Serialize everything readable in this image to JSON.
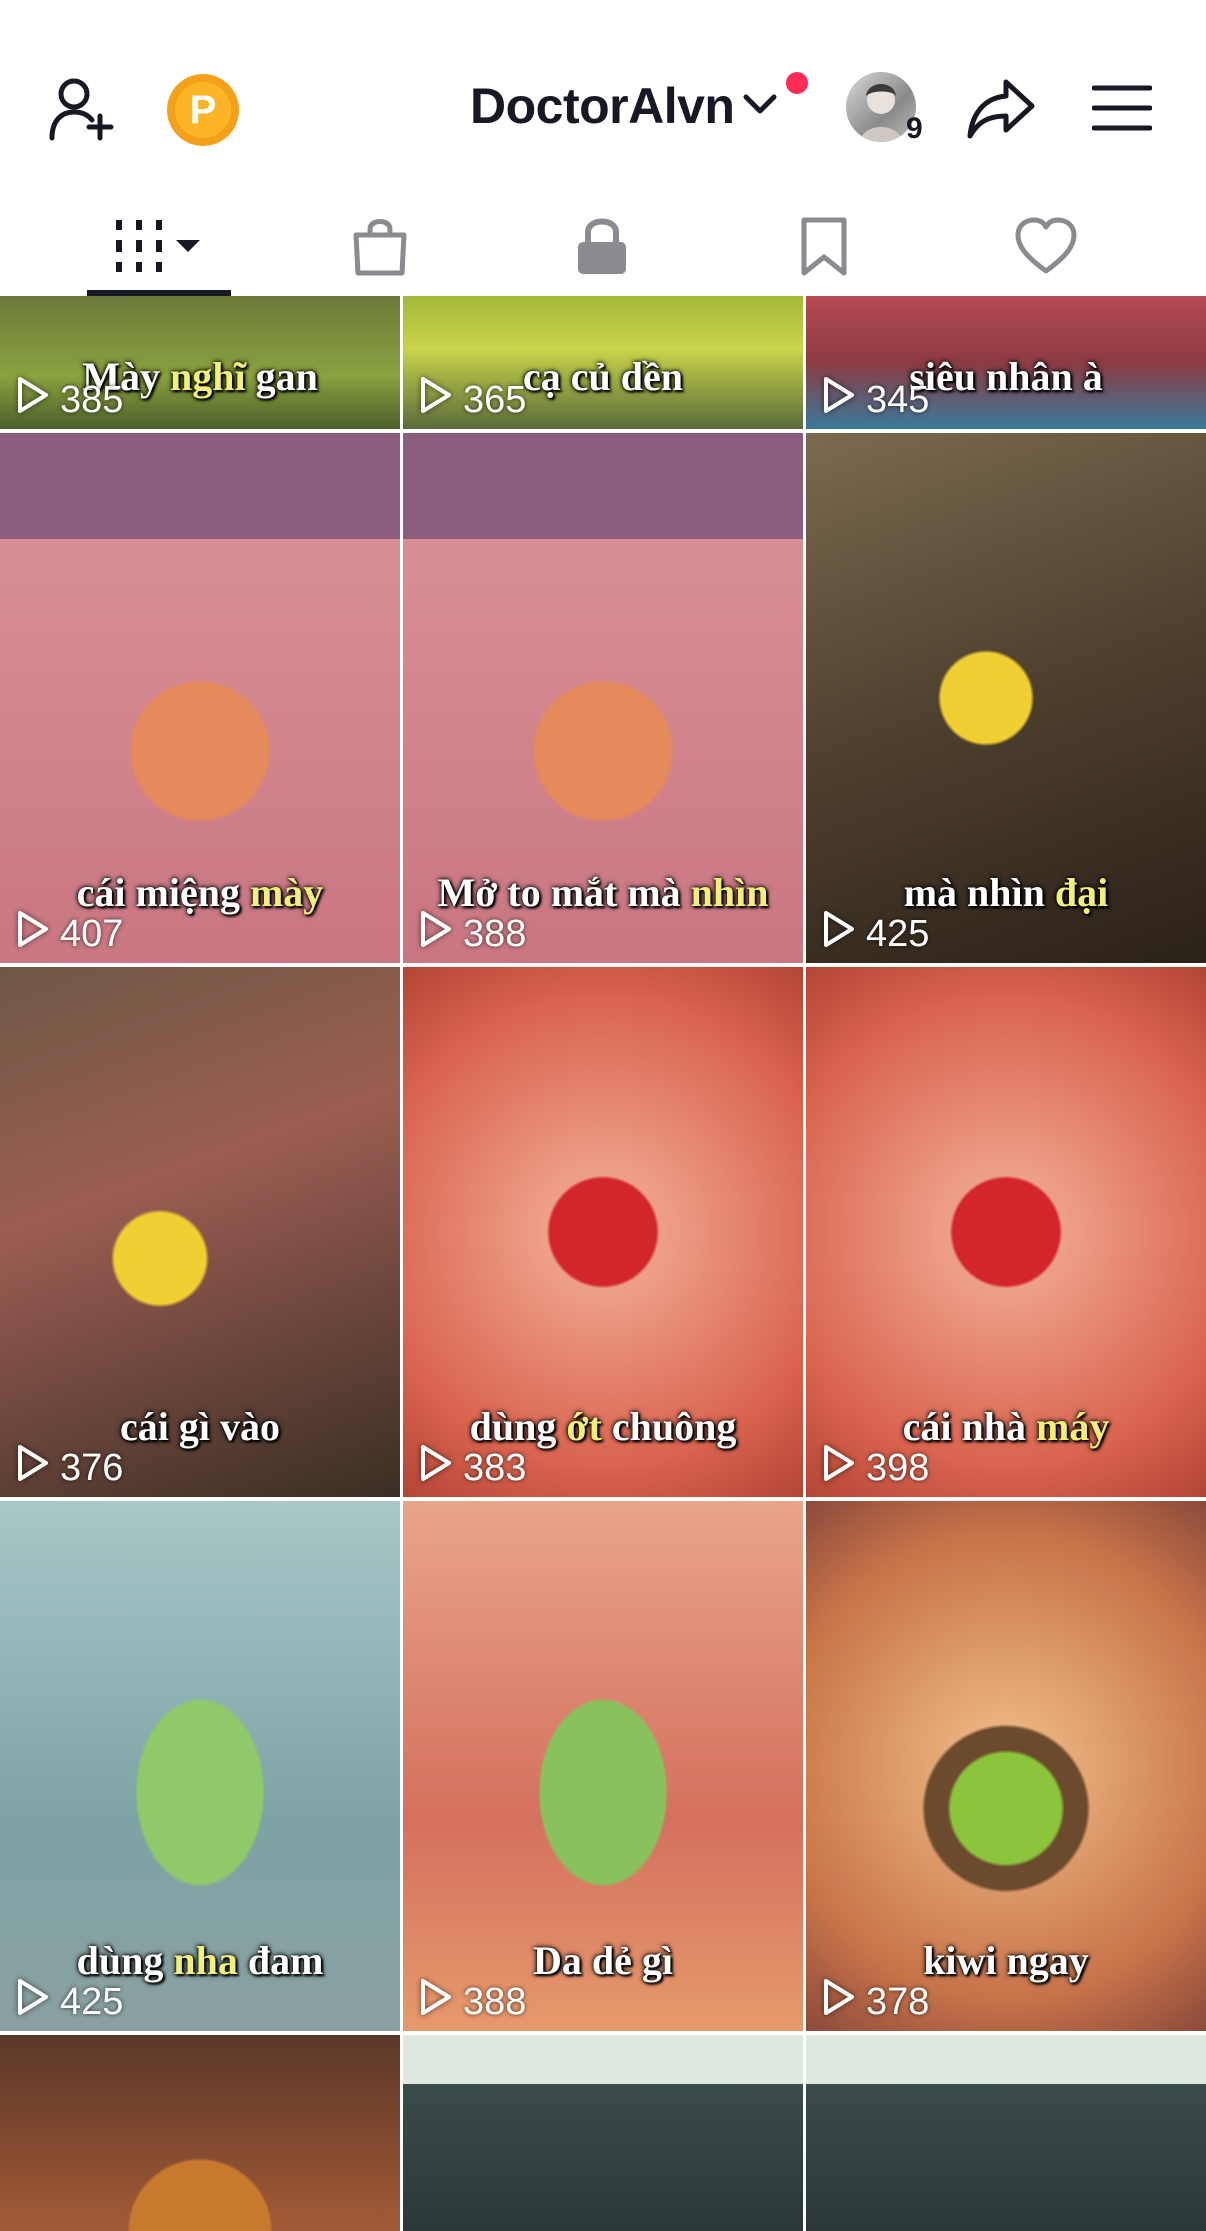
{
  "header": {
    "username": "DoctorAlvn",
    "premium_badge": "P",
    "following_count": "9",
    "icons": [
      "add-friend-icon",
      "premium-badge-icon",
      "chevron-down-icon",
      "share-icon",
      "menu-icon"
    ]
  },
  "tabs": [
    {
      "name": "videos",
      "icon": "grid-icon",
      "active": true
    },
    {
      "name": "shop",
      "icon": "bag-icon",
      "active": false
    },
    {
      "name": "private",
      "icon": "lock-icon",
      "active": false
    },
    {
      "name": "saved",
      "icon": "bookmark-icon",
      "active": false
    },
    {
      "name": "liked",
      "icon": "heart-icon",
      "active": false
    }
  ],
  "colors": {
    "accent_red": "#fe2c55",
    "text": "#161823",
    "badge_orange": "#f5a01a",
    "caption_highlight": "#f3f07a"
  },
  "videos": [
    {
      "views": "385",
      "caption_a": "Mày ",
      "caption_hl": "nghĩ",
      "caption_b": " gan"
    },
    {
      "views": "365",
      "caption_a": "cạ củ dền",
      "caption_hl": "",
      "caption_b": ""
    },
    {
      "views": "345",
      "caption_a": "siêu nhân à",
      "caption_hl": "",
      "caption_b": ""
    },
    {
      "views": "407",
      "caption_a": "cái miệng ",
      "caption_hl": "mày",
      "caption_b": ""
    },
    {
      "views": "388",
      "caption_a": "Mở to mắt mà ",
      "caption_hl": "nhìn",
      "caption_b": ""
    },
    {
      "views": "425",
      "caption_a": "mà nhìn ",
      "caption_hl": "đại",
      "caption_b": ""
    },
    {
      "views": "376",
      "caption_a": "cái gì vào",
      "caption_hl": "",
      "caption_b": ""
    },
    {
      "views": "383",
      "caption_a": "dùng ",
      "caption_hl": "ớt",
      "caption_b": " chuông"
    },
    {
      "views": "398",
      "caption_a": "cái nhà ",
      "caption_hl": "máy",
      "caption_b": ""
    },
    {
      "views": "425",
      "caption_a": "dùng ",
      "caption_hl": "nha",
      "caption_b": " đam"
    },
    {
      "views": "388",
      "caption_a": "Da dẻ gì",
      "caption_hl": "",
      "caption_b": ""
    },
    {
      "views": "378",
      "caption_a": "kiwi ngay",
      "caption_hl": "",
      "caption_b": ""
    },
    {
      "views": "",
      "caption_a": "",
      "caption_hl": "",
      "caption_b": ""
    },
    {
      "views": "",
      "caption_a": "",
      "caption_hl": "",
      "caption_b": ""
    },
    {
      "views": "",
      "caption_a": "",
      "caption_hl": "",
      "caption_b": ""
    }
  ]
}
